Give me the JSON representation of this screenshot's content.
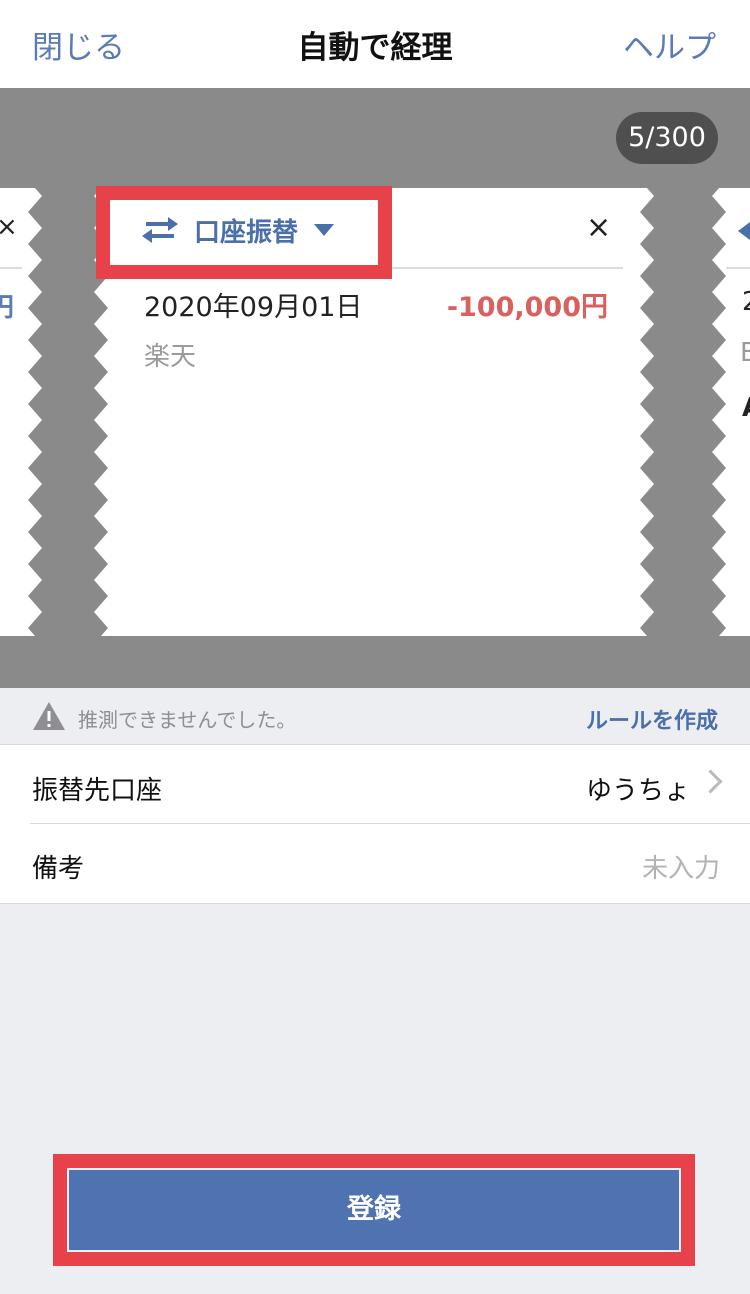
{
  "header": {
    "close_label": "閉じる",
    "title": "自動で経理",
    "help_label": "ヘルプ"
  },
  "carousel": {
    "counter": "5/300",
    "card": {
      "type_label": "口座振替",
      "type_icon": "transfer-arrows-icon",
      "close_symbol": "×",
      "date": "2020年09月01日",
      "amount": "-100,000円",
      "account": "楽天"
    },
    "peek_left": {
      "close_symbol": "×",
      "amount_fragment": "円"
    },
    "peek_right": {
      "date_fragment": "2",
      "sub_fragment": "B",
      "mark_fragment": "A"
    }
  },
  "notice": {
    "icon": "warning-icon",
    "text": "推測できませんでした。",
    "rule_link": "ルールを作成"
  },
  "form": {
    "destination_label": "振替先口座",
    "destination_value": "ゆうちょ",
    "memo_label": "備考",
    "memo_placeholder": "未入力"
  },
  "register_button": "登録",
  "colors": {
    "accent": "#4a6fab",
    "negative_amount": "#d9605c",
    "highlight": "#e74249",
    "band": "#8a8a8a"
  }
}
